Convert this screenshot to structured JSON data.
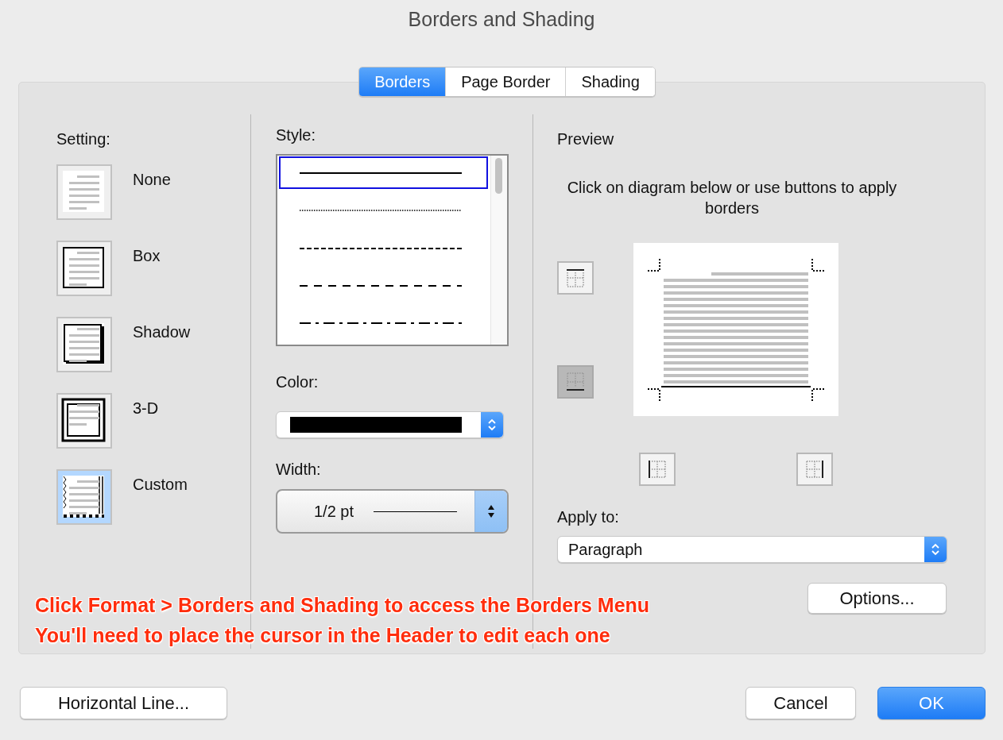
{
  "window": {
    "title": "Borders and Shading"
  },
  "tabs": [
    {
      "label": "Borders",
      "selected": true
    },
    {
      "label": "Page Border",
      "selected": false
    },
    {
      "label": "Shading",
      "selected": false
    }
  ],
  "setting": {
    "label": "Setting:",
    "items": [
      {
        "label": "None",
        "kind": "none",
        "selected": false
      },
      {
        "label": "Box",
        "kind": "box",
        "selected": false
      },
      {
        "label": "Shadow",
        "kind": "shadow",
        "selected": false
      },
      {
        "label": "3-D",
        "kind": "three-d",
        "selected": false
      },
      {
        "label": "Custom",
        "kind": "custom",
        "selected": true
      }
    ]
  },
  "style": {
    "label": "Style:",
    "lines": [
      {
        "kind": "solid",
        "selected": true
      },
      {
        "kind": "dotted",
        "selected": false
      },
      {
        "kind": "dashed",
        "selected": false
      },
      {
        "kind": "wide-dashed",
        "selected": false
      },
      {
        "kind": "dash-dot",
        "selected": false
      }
    ]
  },
  "color": {
    "label": "Color:"
  },
  "width": {
    "label": "Width:",
    "value": "1/2 pt"
  },
  "preview": {
    "label": "Preview",
    "instruction": "Click on diagram below or use buttons to apply borders",
    "border_buttons": [
      {
        "kind": "top",
        "selected": false
      },
      {
        "kind": "bottom",
        "selected": true
      },
      {
        "kind": "left",
        "selected": false
      },
      {
        "kind": "right",
        "selected": false
      }
    ]
  },
  "apply_to": {
    "label": "Apply to:",
    "value": "Paragraph"
  },
  "options_button": "Options...",
  "annotation": [
    "Click Format > Borders and Shading to access the Borders Menu",
    "You'll need to place the cursor in the Header to edit each one"
  ],
  "footer": {
    "horizontal_line_button": "Horizontal Line...",
    "cancel_button": "Cancel",
    "ok_button": "OK"
  }
}
